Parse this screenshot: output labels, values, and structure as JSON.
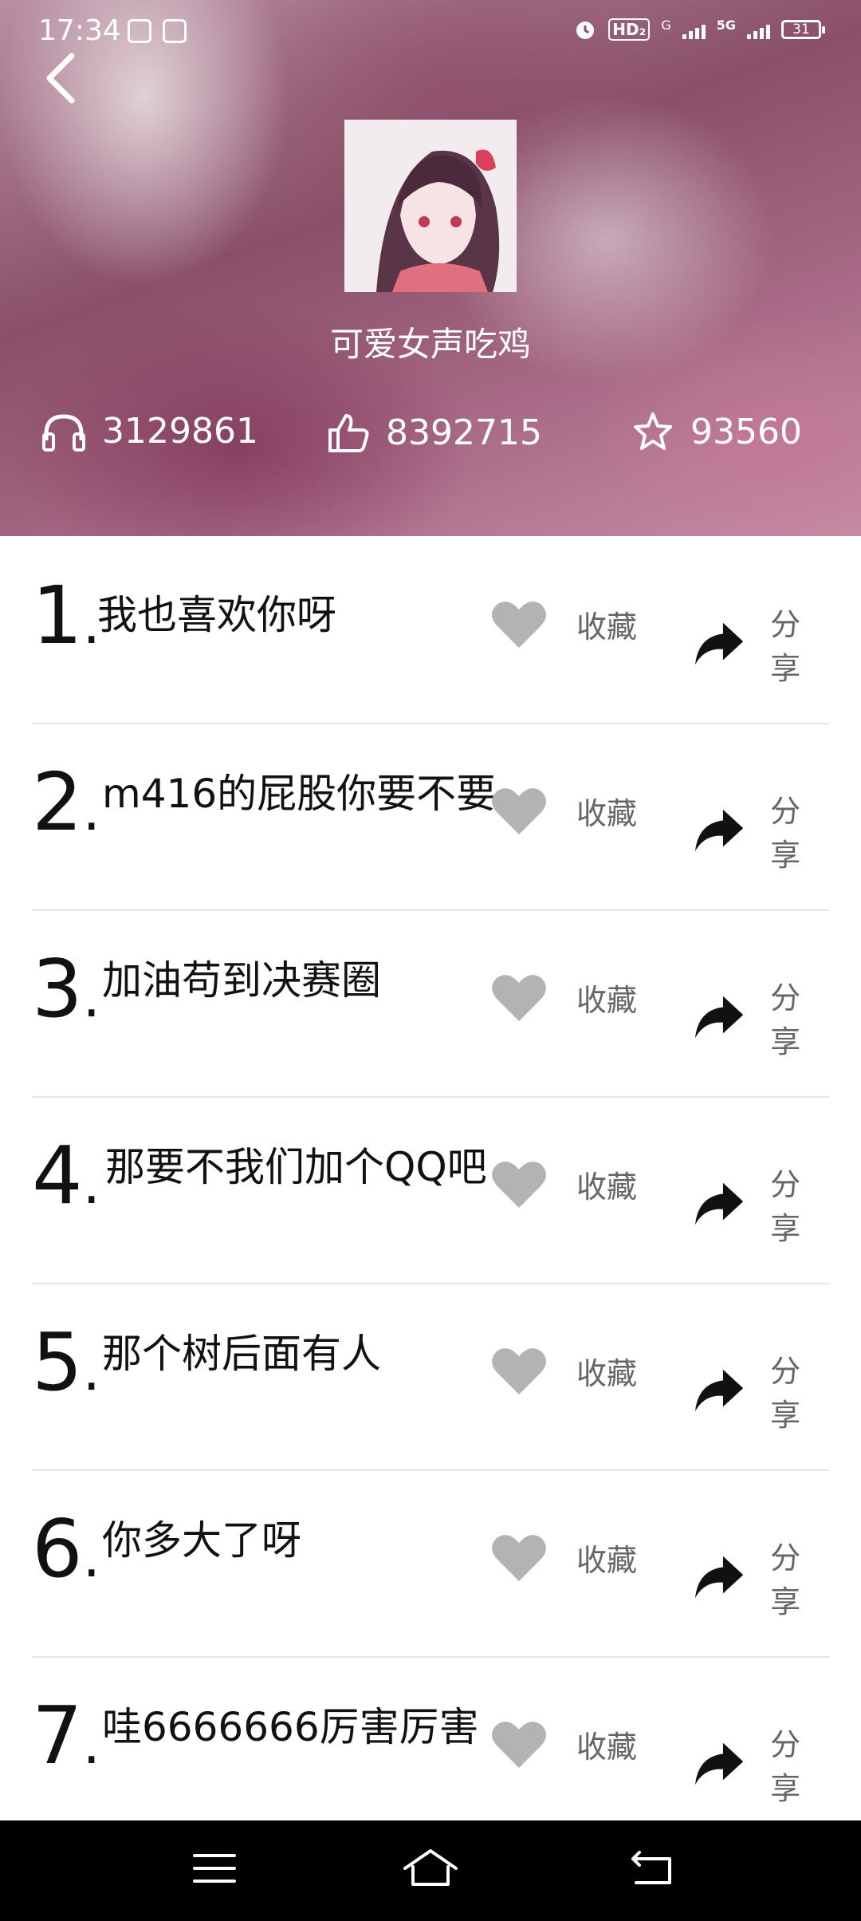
{
  "status_bar": {
    "time": "17:34",
    "network_hd": "HD₂",
    "network_g": "G",
    "network_5g": "5G",
    "battery": "31"
  },
  "header": {
    "title": "可爱女声吃鸡",
    "stats": [
      {
        "icon": "headphones-icon",
        "value": "3129861"
      },
      {
        "icon": "thumbs-up-icon",
        "value": "8392715"
      },
      {
        "icon": "star-icon",
        "value": "93560"
      }
    ]
  },
  "actions": {
    "favorite_label": "收藏",
    "share_label": "分享"
  },
  "items": [
    {
      "number": "1",
      "text": "我也喜欢你呀"
    },
    {
      "number": "2",
      "text": "m416的屁股你要不要"
    },
    {
      "number": "3",
      "text": "加油苟到决赛圈"
    },
    {
      "number": "4",
      "text": "那要不我们加个QQ吧"
    },
    {
      "number": "5",
      "text": "那个树后面有人"
    },
    {
      "number": "6",
      "text": "你多大了呀"
    },
    {
      "number": "7",
      "text": "哇6666666厉害厉害"
    }
  ],
  "colors": {
    "heart": "#b3b3b3",
    "share_arrow": "#111111",
    "divider": "#e5e5e5",
    "navbar": "#000000"
  }
}
